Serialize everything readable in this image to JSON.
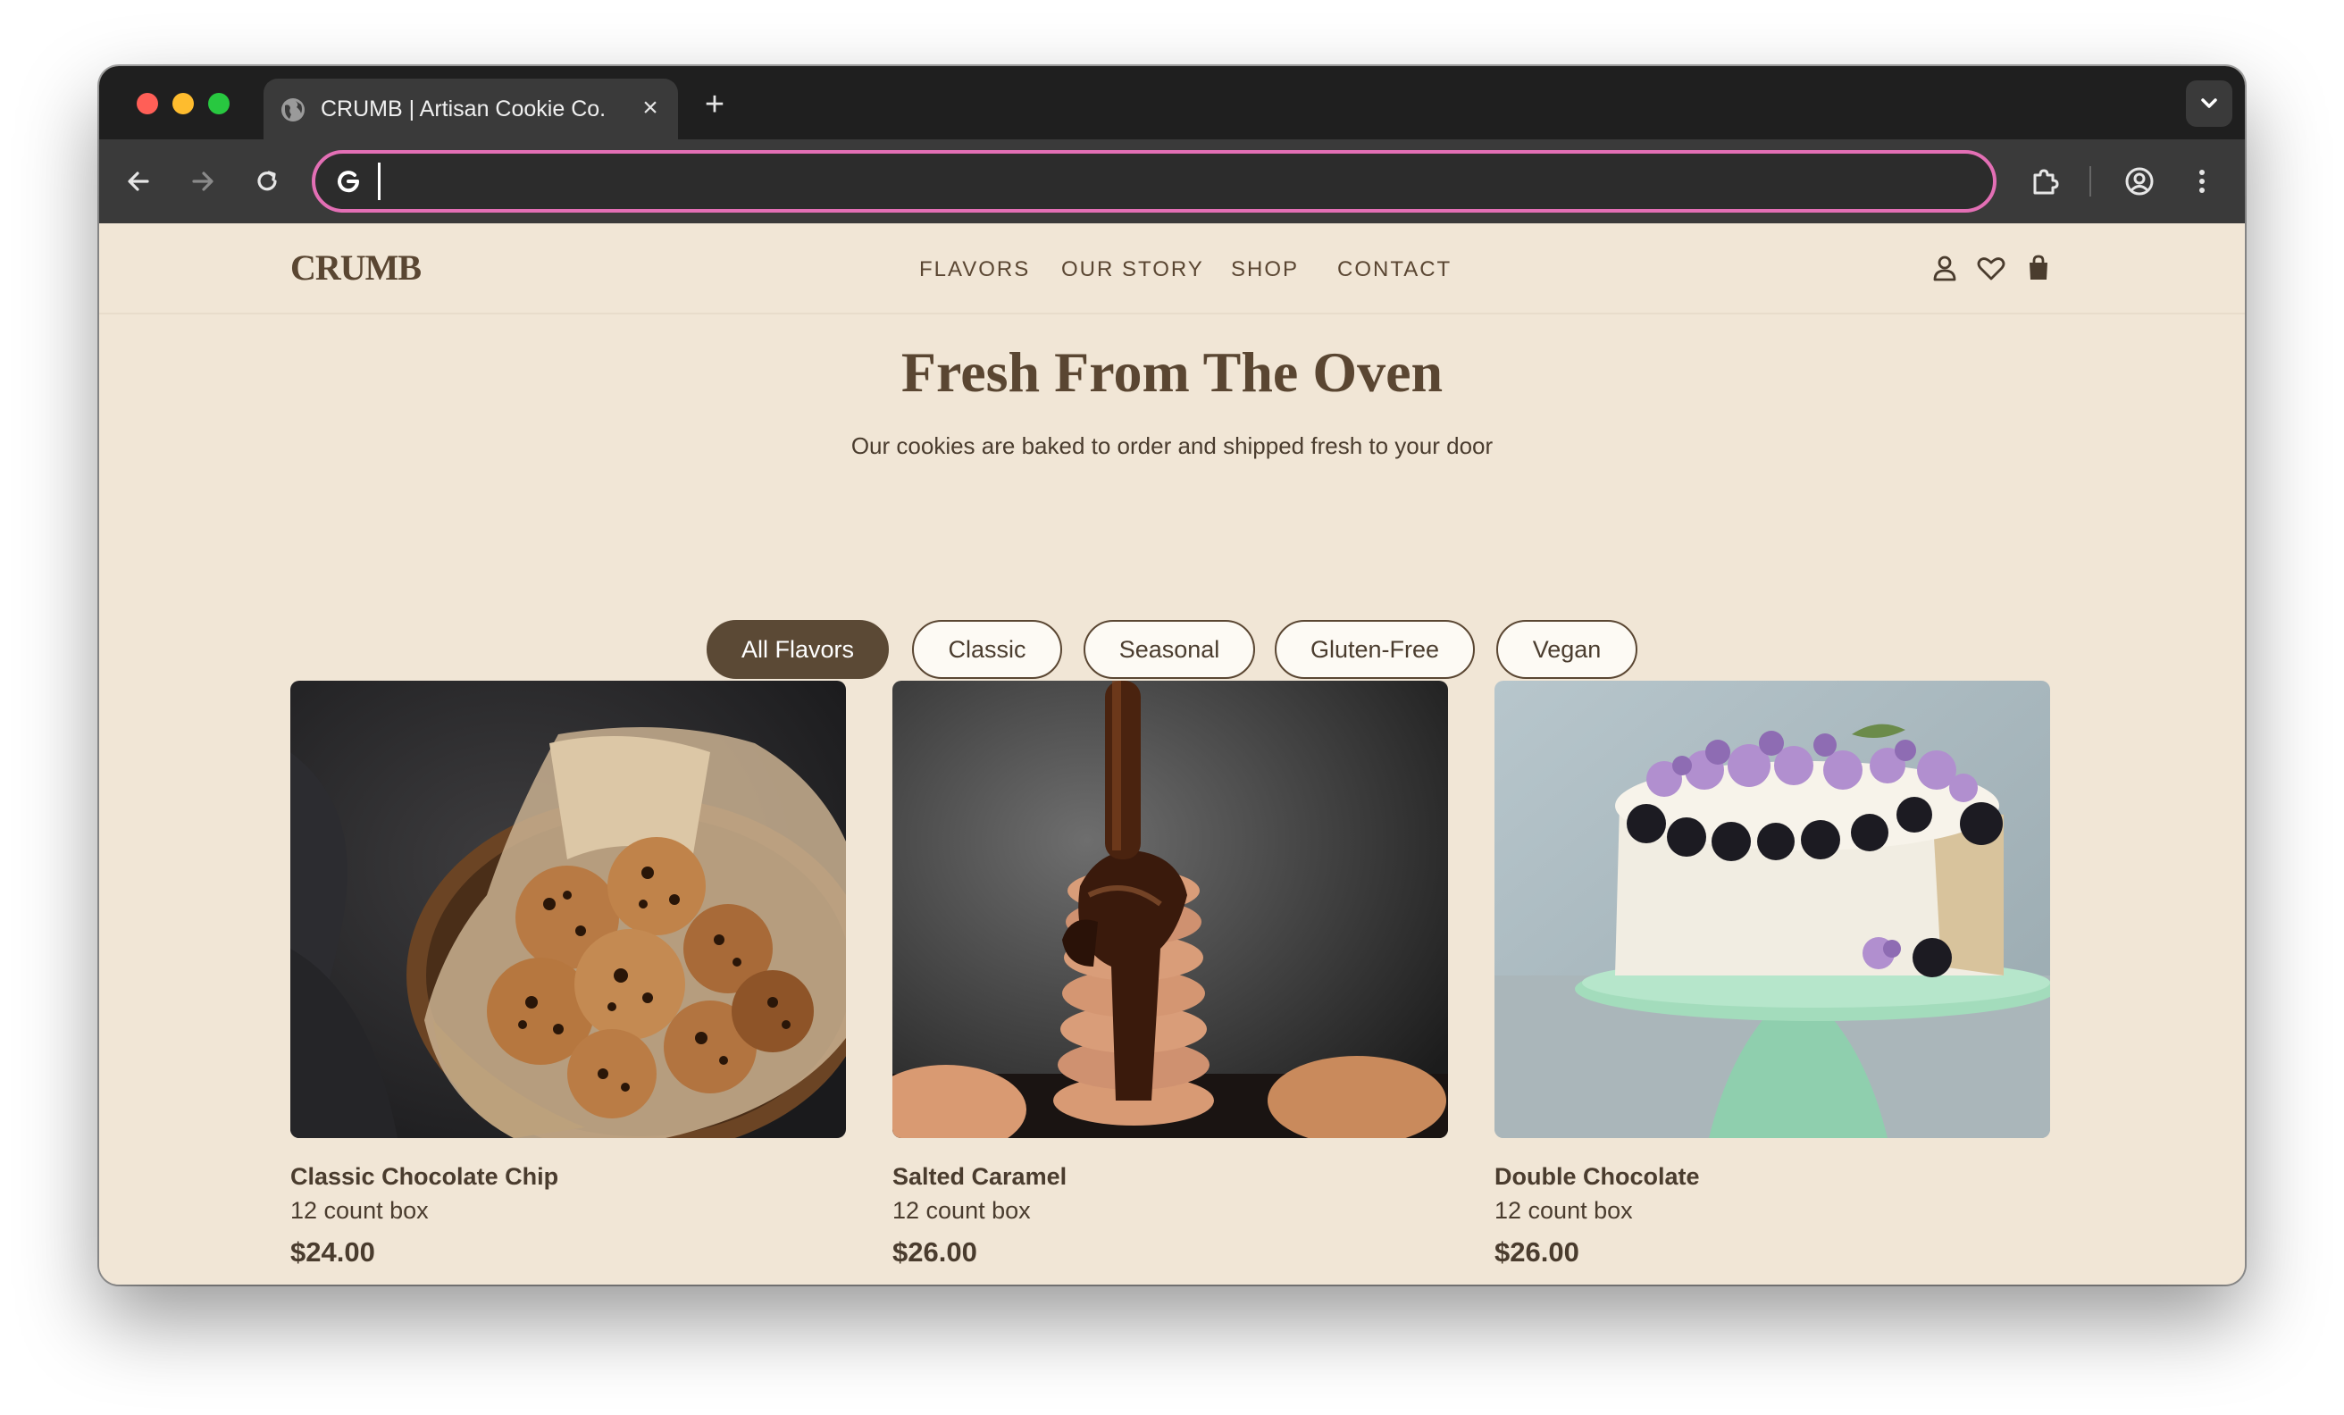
{
  "browser": {
    "tab_title": "CRUMB | Artisan Cookie Co.",
    "tab_close": "×",
    "new_tab": "+",
    "address_value": "",
    "highlight_color": "#e36fb5"
  },
  "site": {
    "logo": "CRUMB",
    "nav": [
      "FLAVORS",
      "OUR STORY",
      "SHOP",
      "CONTACT"
    ],
    "header_icons": [
      "account-icon",
      "wishlist-heart-icon",
      "shopping-bag-icon"
    ],
    "brand_color": "#5a4632",
    "background_color": "#f1e6d6"
  },
  "hero": {
    "title": "Fresh From The Oven",
    "subtitle": "Our cookies are baked to order and shipped fresh to your door"
  },
  "filters": {
    "items": [
      "All Flavors",
      "Classic",
      "Seasonal",
      "Gluten-Free",
      "Vegan"
    ],
    "selected": "All Flavors"
  },
  "products": [
    {
      "name": "Classic Chocolate Chip",
      "size": "12 count box",
      "price": "$24.00",
      "image": "cookies-in-bowl-photo"
    },
    {
      "name": "Salted Caramel",
      "size": "12 count box",
      "price": "$26.00",
      "image": "chocolate-drizzle-cookie-stack-photo"
    },
    {
      "name": "Double Chocolate",
      "size": "12 count box",
      "price": "$26.00",
      "image": "blackberry-lilac-cake-photo"
    }
  ]
}
